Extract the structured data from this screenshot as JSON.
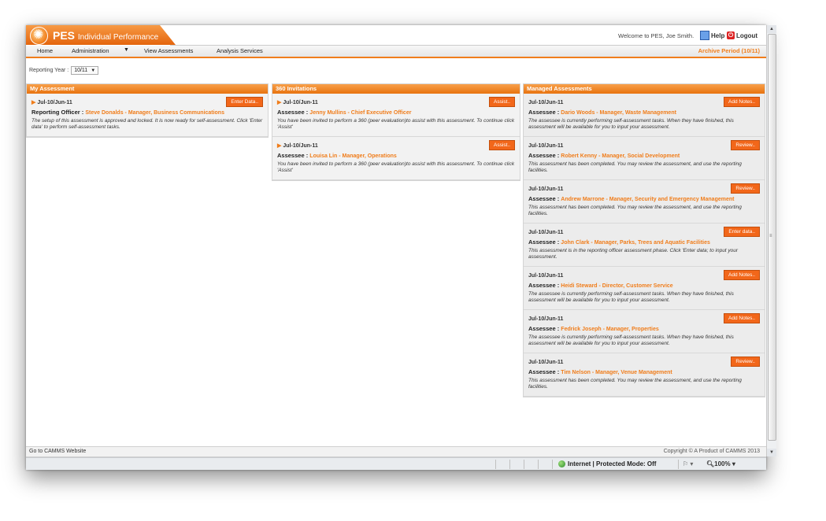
{
  "header": {
    "brand": "PES",
    "brand_sub": "Individual Performance",
    "welcome": "Welcome to PES, Joe Smith.",
    "help": "Help",
    "logout": "Logout"
  },
  "nav": {
    "items": [
      "Home",
      "Administration",
      "View Assessments",
      "Analysis Services"
    ],
    "archive": "Archive Period (10/11)"
  },
  "reporting_year": {
    "label": "Reporting Year :",
    "value": "10/11"
  },
  "my_assessment": {
    "title": "My Assessment",
    "cards": [
      {
        "period": "Jul-10/Jun-11",
        "button": "Enter Data..",
        "role": "Reporting Officer :",
        "name": "Steve Donalds - Manager, Business Communications",
        "message": "The setup of this assessment is approved and locked. It is now ready for self-assessment. Click 'Enter data' to perform self-assessment tasks."
      }
    ]
  },
  "invitations": {
    "title": "360 Invitations",
    "cards": [
      {
        "period": "Jul-10/Jun-11",
        "button": "Assist..",
        "role": "Assessee :",
        "name": "Jenny Mullins - Chief Executive Officer",
        "message": "You have been invited to perform a 360 (peer evaluation)to assist with this assessment. To continue click 'Assist'"
      },
      {
        "period": "Jul-10/Jun-11",
        "button": "Assist..",
        "role": "Assessee :",
        "name": "Louisa Lin - Manager, Operations",
        "message": "You have been invited to perform a 360 (peer evaluation)to assist with this assessment. To continue click 'Assist'"
      }
    ]
  },
  "managed": {
    "title": "Managed Assessments",
    "cards": [
      {
        "period": "Jul-10/Jun-11",
        "button": "Add Notes..",
        "role": "Assessee :",
        "name": "Dario Woods - Manager, Waste Management",
        "message": "The assessee is currently performing self-assessment tasks. When they have finished, this assessment will be available for you to input your assessment."
      },
      {
        "period": "Jul-10/Jun-11",
        "button": "Review..",
        "role": "Assessee :",
        "name": "Robert Kenny - Manager, Social Development",
        "message": "This assessment has been completed. You may review the assessment, and use the reporting facilities."
      },
      {
        "period": "Jul-10/Jun-11",
        "button": "Review..",
        "role": "Assessee :",
        "name": "Andrew Marrone - Manager, Security and Emergency Management",
        "message": "This assessment has been completed. You may review the assessment, and use the reporting facilities."
      },
      {
        "period": "Jul-10/Jun-11",
        "button": "Enter data..",
        "role": "Assessee :",
        "name": "John Clark - Manager, Parks, Trees and Aquatic Facilities",
        "message": "This assessment is in the reporting officer assessment phase. Click 'Enter data; to input your assessment."
      },
      {
        "period": "Jul-10/Jun-11",
        "button": "Add Notes..",
        "role": "Assessee :",
        "name": "Heidi Steward - Director, Customer Service",
        "message": "The assessee is currently performing self-assessment tasks. When they have finished, this assessment will be available for you to input your assessment."
      },
      {
        "period": "Jul-10/Jun-11",
        "button": "Add Notes..",
        "role": "Assessee :",
        "name": "Fedrick Joseph - Manager, Properties",
        "message": "The assessee is currently performing self-assessment tasks. When they have finished, this assessment will be available for you to input your assessment."
      },
      {
        "period": "Jul-10/Jun-11",
        "button": "Review..",
        "role": "Assessee :",
        "name": "Tim Nelson - Manager, Venue Management",
        "message": "This assessment has been completed. You may review the assessment, and use the reporting facilities."
      }
    ]
  },
  "footer": {
    "left": "Go to CAMMS Website",
    "right": "Copyright © A Product of CAMMS 2013"
  },
  "status": {
    "zone": "Internet | Protected Mode: Off",
    "zoom": "100%"
  },
  "colors": {
    "accent": "#f07d1b",
    "button": "#f2671a"
  }
}
